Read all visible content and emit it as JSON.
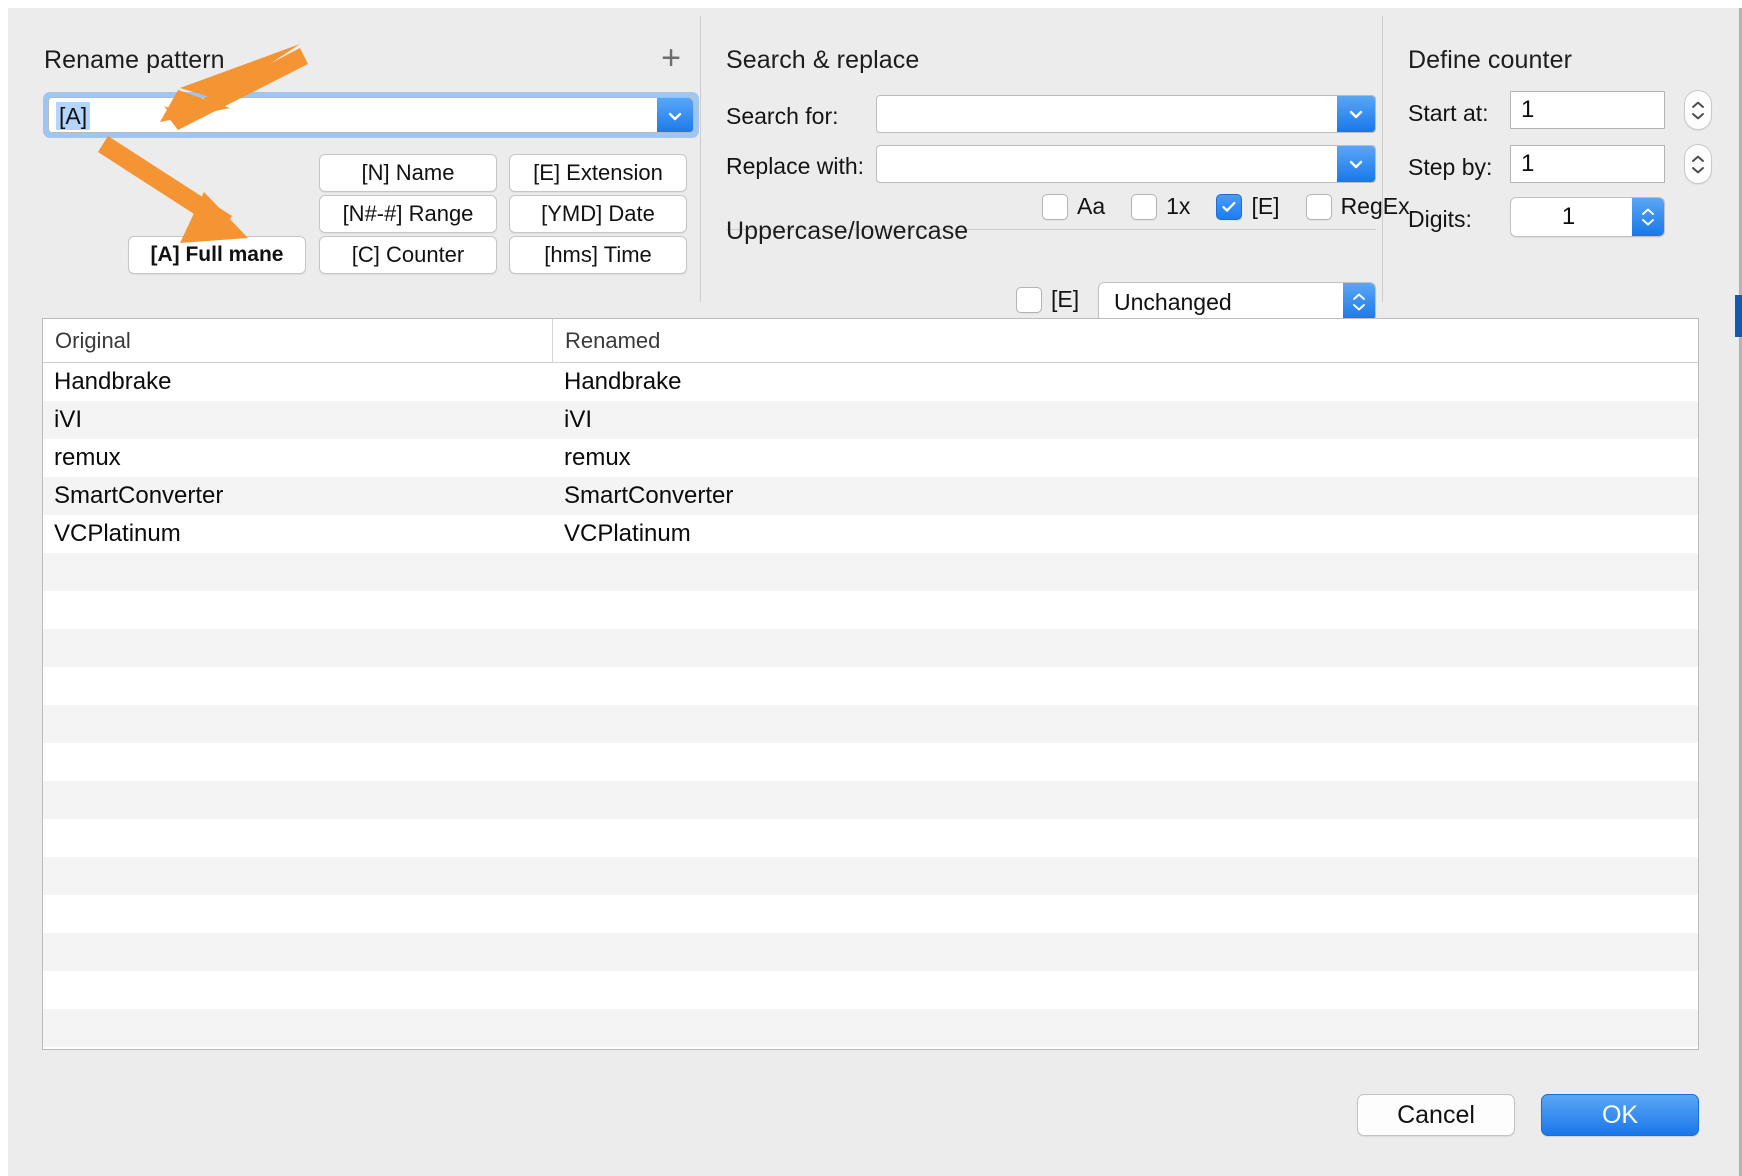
{
  "panels": {
    "rename_pattern": {
      "title": "Rename pattern",
      "add_icon": "+",
      "pattern_value": "[A]",
      "tokens": [
        {
          "label": "[A] Full mane",
          "bold": true
        },
        {
          "label": "[N] Name",
          "bold": false
        },
        {
          "label": "[E] Extension",
          "bold": false
        },
        {
          "label": "[N#-#] Range",
          "bold": false
        },
        {
          "label": "[YMD] Date",
          "bold": false
        },
        {
          "label": "[C] Counter",
          "bold": false
        },
        {
          "label": "[hms] Time",
          "bold": false
        }
      ]
    },
    "search_replace": {
      "title": "Search & replace",
      "search_for_label": "Search for:",
      "search_for_value": "",
      "replace_with_label": "Replace with:",
      "replace_with_value": "",
      "options": [
        {
          "label": "Aa",
          "checked": false
        },
        {
          "label": "1x",
          "checked": false
        },
        {
          "label": "[E]",
          "checked": true
        },
        {
          "label": "RegEx",
          "checked": false
        }
      ],
      "case_section_title": "Uppercase/lowercase",
      "case_extension_label": "[E]",
      "case_extension_checked": false,
      "case_mode_value": "Unchanged"
    },
    "define_counter": {
      "title": "Define counter",
      "start_at_label": "Start at:",
      "start_at_value": "1",
      "step_by_label": "Step by:",
      "step_by_value": "1",
      "digits_label": "Digits:",
      "digits_value": "1"
    }
  },
  "table": {
    "columns": [
      "Original",
      "Renamed"
    ],
    "rows": [
      {
        "original": "Handbrake",
        "renamed": "Handbrake"
      },
      {
        "original": "iVI",
        "renamed": "iVI"
      },
      {
        "original": "remux",
        "renamed": "remux"
      },
      {
        "original": "SmartConverter",
        "renamed": "SmartConverter"
      },
      {
        "original": "VCPlatinum",
        "renamed": "VCPlatinum"
      }
    ],
    "empty_row_count": 13
  },
  "footer": {
    "cancel_label": "Cancel",
    "ok_label": "OK"
  },
  "annotations": {
    "arrow_color": "#F59432",
    "arrow_to_pattern_field": "arrow-pointing-to-pattern-field",
    "arrow_to_full_name_token": "arrow-pointing-to-full-name-token"
  },
  "colors": {
    "accent_blue": "#1878E9",
    "window_bg": "#ECECEC",
    "row_alt": "#F4F4F4",
    "selection_blue": "#B4D5FB",
    "edge_scroll_blue": "#0D5BB5"
  }
}
